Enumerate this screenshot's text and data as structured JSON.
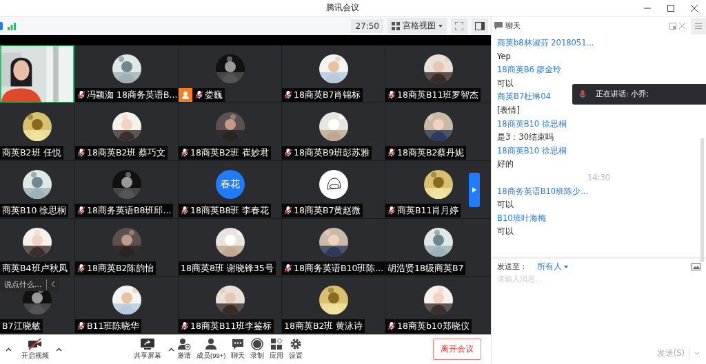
{
  "window": {
    "title": "腾讯会议"
  },
  "toolbar": {
    "timer": "27:50",
    "view": "宫格视图"
  },
  "tiles": [
    [
      {
        "kind": "video",
        "speaking": true
      },
      {
        "name": "冯颖洳 18商务英语B...",
        "muted": true,
        "speaking": false,
        "host": false
      },
      {
        "name": "娄巍",
        "muted": true,
        "speaking": false,
        "host": true
      },
      {
        "name": "18商英B7肖锦标",
        "muted": true,
        "speaking": false,
        "host": false
      },
      {
        "name": "18商英B11班罗智杰",
        "muted": true,
        "speaking": false,
        "host": false
      }
    ],
    [
      {
        "name": "商英B2班 任悦",
        "muted": false,
        "speaking": false,
        "host": false
      },
      {
        "name": "18商英B2班 蔡巧文",
        "muted": true,
        "speaking": false,
        "host": false
      },
      {
        "name": "18商英B2班 崔妙君",
        "muted": true,
        "speaking": false,
        "host": false
      },
      {
        "name": "18商英B9班彭苏雅",
        "muted": true,
        "speaking": false,
        "host": false
      },
      {
        "name": "18商英B2蔡丹妮",
        "muted": true,
        "speaking": false,
        "host": false
      }
    ],
    [
      {
        "name": "商英B10 徐思桐",
        "muted": false,
        "speaking": false,
        "host": false
      },
      {
        "name": "18商务英语B8班邱...",
        "muted": true,
        "speaking": false,
        "host": false
      },
      {
        "kind": "initials",
        "initials": "春花",
        "name": "18商英B8班 李春花",
        "muted": true,
        "speaking": false,
        "host": false
      },
      {
        "kind": "drawing",
        "name": "18商英B7黄赵微",
        "muted": true,
        "speaking": false,
        "host": false
      },
      {
        "name": "商英B11肖月婷",
        "muted": true,
        "speaking": false,
        "host": false
      }
    ],
    [
      {
        "name": "商英B4班卢秋凤",
        "muted": false,
        "speaking": false,
        "host": false
      },
      {
        "name": "18商英B2陈韵怡",
        "muted": true,
        "speaking": false,
        "host": false
      },
      {
        "name": "18商英8班 谢晓锋35号",
        "muted": false,
        "speaking": false,
        "host": false
      },
      {
        "name": "18商务英语B10班陈...",
        "muted": true,
        "speaking": false,
        "host": false
      },
      {
        "name": "胡浩贤18级商英B7",
        "muted": false,
        "speaking": false,
        "host": false
      }
    ],
    [
      {
        "name": "B7江晓敏",
        "muted": false,
        "speaking": false,
        "host": false
      },
      {
        "name": "B11班陈晓华",
        "muted": true,
        "speaking": false,
        "host": false
      },
      {
        "name": "18商英B11班李鉴标",
        "muted": true,
        "speaking": false,
        "host": false
      },
      {
        "name": "18商英B2班 黄泳诗",
        "muted": false,
        "speaking": false,
        "host": false
      },
      {
        "name": "18商英b10郑晓仪",
        "muted": true,
        "speaking": false,
        "host": false
      }
    ]
  ],
  "comment_bar": {
    "placeholder": "说点什么..."
  },
  "controls": [
    {
      "kind": "camera-off",
      "label": "开启视频",
      "caret": true
    },
    {
      "kind": "share",
      "label": "共享屏幕",
      "caret": true
    },
    {
      "kind": "invite",
      "label": "邀请",
      "caret": false
    },
    {
      "kind": "members",
      "label": "成员(99+)",
      "caret": false
    },
    {
      "kind": "chat",
      "label": "聊天",
      "caret": false
    },
    {
      "kind": "record",
      "label": "录制",
      "caret": false
    },
    {
      "kind": "apps",
      "label": "应用",
      "caret": false
    },
    {
      "kind": "settings",
      "label": "设置",
      "caret": false
    }
  ],
  "leave_button": "离开会议",
  "chat": {
    "title": "聊天",
    "messages": [
      {
        "kind": "sender",
        "text": "商英b8林淑芬 2018051..."
      },
      {
        "kind": "text",
        "text": "Yep"
      },
      {
        "kind": "sender",
        "text": "18商英B6  廖金玲"
      },
      {
        "kind": "text",
        "text": "可以"
      },
      {
        "kind": "sender",
        "text": "商英B7杜琳04"
      },
      {
        "kind": "text",
        "text": "[表情]"
      },
      {
        "kind": "sender",
        "text": "18商英B10 徐思桐"
      },
      {
        "kind": "text",
        "text": "是3：30结束吗"
      },
      {
        "kind": "sender",
        "text": "18商英B10 徐思桐"
      },
      {
        "kind": "text",
        "text": "好的"
      },
      {
        "kind": "time",
        "text": "14:30"
      },
      {
        "kind": "sender",
        "text": "18商务英语B10班陈少..."
      },
      {
        "kind": "text",
        "text": "可以"
      },
      {
        "kind": "sender",
        "text": "B10班叶海梅"
      },
      {
        "kind": "text",
        "text": "可以"
      }
    ],
    "send_to_label": "发送至：",
    "recipient": "所有人",
    "placeholder": "请输入消息...",
    "send_button": "发送(S)"
  },
  "speaking_toast": "正在讲话: 小乔;"
}
